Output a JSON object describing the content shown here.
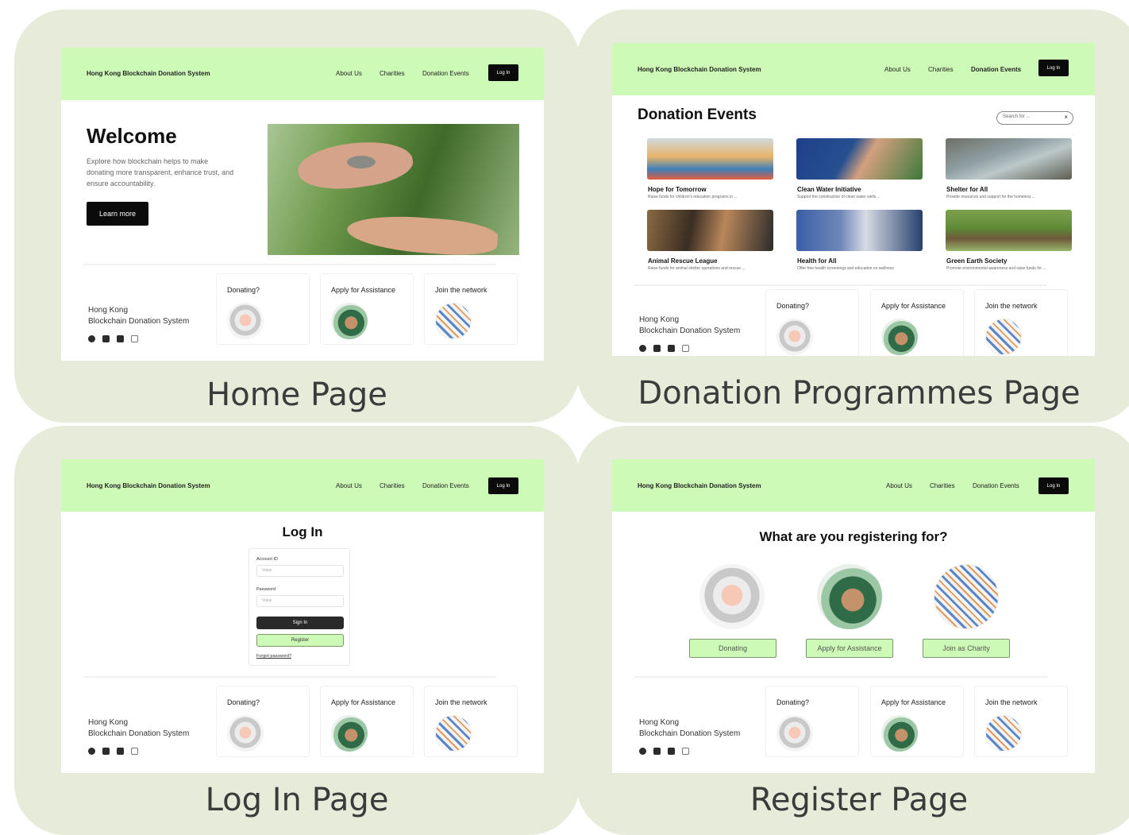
{
  "captions": {
    "home": "Home Page",
    "donation": "Donation Programmes Page",
    "login": "Log In Page",
    "register": "Register Page"
  },
  "nav": {
    "brand": "Hong Kong Blockchain Donation System",
    "about": "About Us",
    "charities": "Charities",
    "donation_events": "Donation Events",
    "login": "Log In"
  },
  "footer": {
    "brand_line1": "Hong Kong",
    "brand_line2": "Blockchain Donation System",
    "social_icons": [
      "circle-icon",
      "square-icon",
      "video-icon",
      "camera-icon"
    ],
    "cards": {
      "donating": "Donating?",
      "apply": "Apply for Assistance",
      "join": "Join the network"
    }
  },
  "home": {
    "title": "Welcome",
    "description": "Explore how blockchain helps to make donating more transparent, enhance trust, and ensure accountability.",
    "cta": "Learn more"
  },
  "donation": {
    "title": "Donation Events",
    "search_placeholder": "Search for ...",
    "events": [
      {
        "title": "Hope for Tomorrow",
        "desc": "Raise funds for children's education programs in ..."
      },
      {
        "title": "Clean Water Initiative",
        "desc": "Support the construction of clean water wells ..."
      },
      {
        "title": "Shelter for All",
        "desc": "Provide resources and support for the homeless ..."
      },
      {
        "title": "Animal Rescue League",
        "desc": "Raise funds for animal shelter operations and rescue ..."
      },
      {
        "title": "Health for All",
        "desc": "Offer free health screenings and education on wellness"
      },
      {
        "title": "Green Earth Society",
        "desc": "Promote environmental awareness and raise funds for ..."
      }
    ]
  },
  "login": {
    "title": "Log In",
    "account_label": "Account ID",
    "account_placeholder": "Value",
    "password_label": "Password",
    "password_placeholder": "Value",
    "signin": "Sign In",
    "register": "Register",
    "forgot": "Forgot password?"
  },
  "register": {
    "question": "What are you registering for?",
    "options": {
      "donating": "Donating",
      "apply": "Apply for Assistance",
      "join": "Join as Charity"
    }
  },
  "colors": {
    "panel_bg": "#e6ecd9",
    "nav_green": "#cdfab6",
    "button_dark": "#0b0b0b"
  }
}
